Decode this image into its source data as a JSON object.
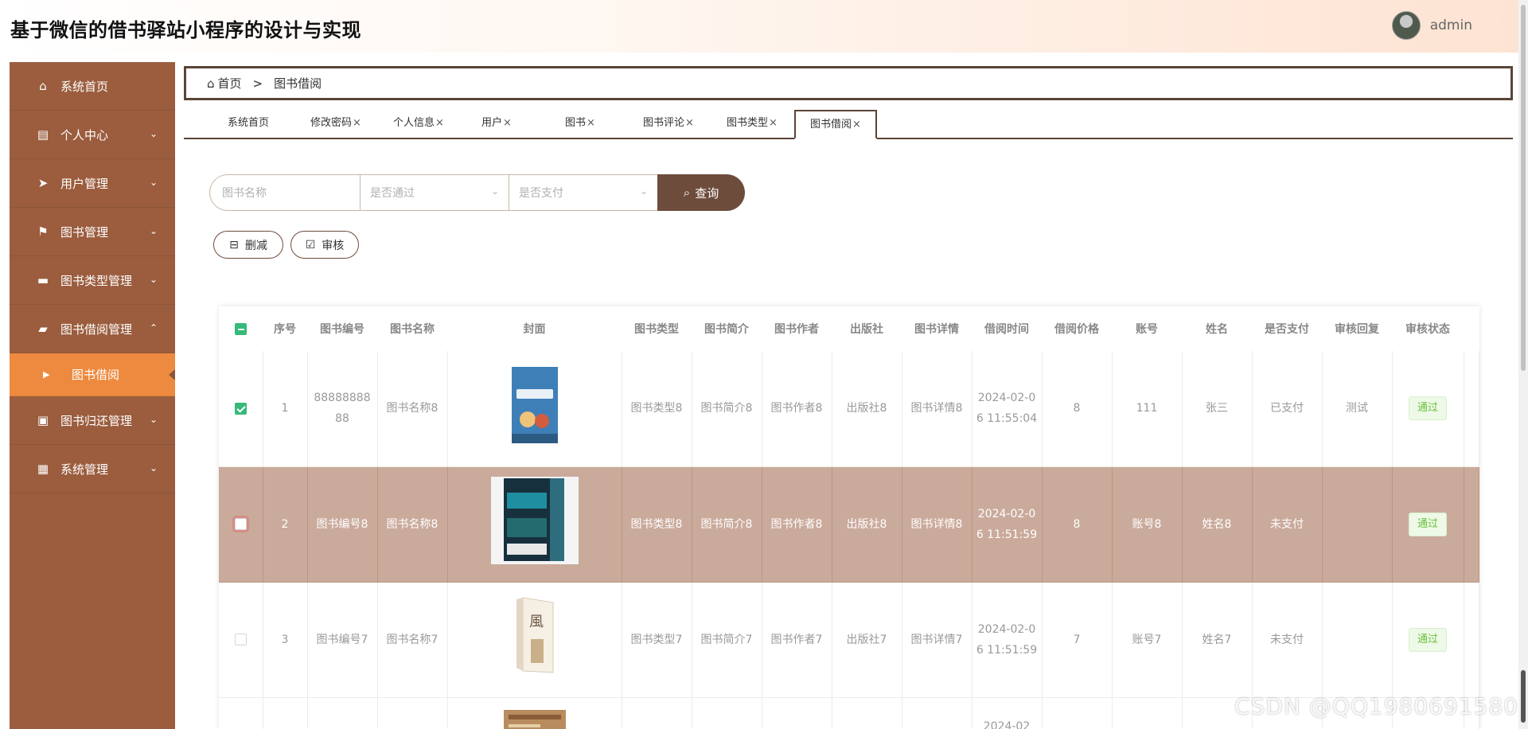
{
  "app": {
    "title": "基于微信的借书驿站小程序的设计与实现",
    "user": "admin"
  },
  "sidebar": {
    "items": [
      {
        "label": "系统首页",
        "icon": "home-icon",
        "glyph": "⌂",
        "chevron": ""
      },
      {
        "label": "个人中心",
        "icon": "id-card-icon",
        "glyph": "▤",
        "chevron": "⌄"
      },
      {
        "label": "用户管理",
        "icon": "send-icon",
        "glyph": "➤",
        "chevron": "⌄"
      },
      {
        "label": "图书管理",
        "icon": "flag-icon",
        "glyph": "⚑",
        "chevron": "⌄"
      },
      {
        "label": "图书类型管理",
        "icon": "chat-icon",
        "glyph": "▬",
        "chevron": "⌄"
      },
      {
        "label": "图书借阅管理",
        "icon": "ticket-icon",
        "glyph": "▰",
        "chevron": "⌃"
      },
      {
        "label": "图书归还管理",
        "icon": "clipboard-icon",
        "glyph": "▣",
        "chevron": "⌄"
      },
      {
        "label": "系统管理",
        "icon": "grid-icon",
        "glyph": "▦",
        "chevron": "⌄"
      }
    ],
    "active_sub": {
      "label": "图书借阅",
      "arrow": "▶"
    }
  },
  "breadcrumb": {
    "home": "首页",
    "separator": ">",
    "current": "图书借阅"
  },
  "tabs": [
    {
      "label": "系统首页",
      "closable": false
    },
    {
      "label": "修改密码",
      "closable": true
    },
    {
      "label": "个人信息",
      "closable": true
    },
    {
      "label": "用户",
      "closable": true
    },
    {
      "label": "图书",
      "closable": true
    },
    {
      "label": "图书评论",
      "closable": true
    },
    {
      "label": "图书类型",
      "closable": true
    },
    {
      "label": "图书借阅",
      "closable": true,
      "active": true
    }
  ],
  "search": {
    "name_placeholder": "图书名称",
    "passed_placeholder": "是否通过",
    "paid_placeholder": "是否支付",
    "button_label": "查询"
  },
  "actions": {
    "delete_label": "删减",
    "audit_label": "审核"
  },
  "table": {
    "headers": [
      "序号",
      "图书编号",
      "图书名称",
      "封面",
      "图书类型",
      "图书简介",
      "图书作者",
      "出版社",
      "图书详情",
      "借阅时间",
      "借阅价格",
      "账号",
      "姓名",
      "是否支付",
      "审核回复",
      "审核状态"
    ],
    "rows": [
      {
        "checked": true,
        "highlight": false,
        "index": "1",
        "book_no": "8888888888",
        "book_name": "图书名称8",
        "cover": "cover-blue",
        "type": "图书类型8",
        "intro": "图书简介8",
        "author": "图书作者8",
        "publisher": "出版社8",
        "detail": "图书详情8",
        "borrow_time": "2024-02-06 11:55:04",
        "price": "8",
        "account": "111",
        "name": "张三",
        "paid": "已支付",
        "reply": "测试",
        "status": "通过"
      },
      {
        "checked": false,
        "highlight": true,
        "index": "2",
        "book_no": "图书编号8",
        "book_name": "图书名称8",
        "cover": "cover-teal",
        "type": "图书类型8",
        "intro": "图书简介8",
        "author": "图书作者8",
        "publisher": "出版社8",
        "detail": "图书详情8",
        "borrow_time": "2024-02-06 11:51:59",
        "price": "8",
        "account": "账号8",
        "name": "姓名8",
        "paid": "未支付",
        "reply": "",
        "status": "通过"
      },
      {
        "checked": false,
        "highlight": false,
        "index": "3",
        "book_no": "图书编号7",
        "book_name": "图书名称7",
        "cover": "cover-white",
        "type": "图书类型7",
        "intro": "图书简介7",
        "author": "图书作者7",
        "publisher": "出版社7",
        "detail": "图书详情7",
        "borrow_time": "2024-02-06 11:51:59",
        "price": "7",
        "account": "账号7",
        "name": "姓名7",
        "paid": "未支付",
        "reply": "",
        "status": "通过"
      },
      {
        "checked": false,
        "highlight": false,
        "index": "",
        "book_no": "",
        "book_name": "",
        "cover": "cover-tan",
        "type": "",
        "intro": "",
        "author": "",
        "publisher": "",
        "detail": "",
        "borrow_time": "2024-02",
        "price": "",
        "account": "",
        "name": "",
        "paid": "",
        "reply": "",
        "status": ""
      }
    ]
  },
  "watermark": "CSDN @QQ1980691580",
  "colors": {
    "sidebar": "#9b5d3e",
    "active": "#ee8a3f",
    "primary": "#6e4c3c",
    "highlight_row": "#caaa9b",
    "success": "#67c23a",
    "checkbox": "#36b979"
  }
}
